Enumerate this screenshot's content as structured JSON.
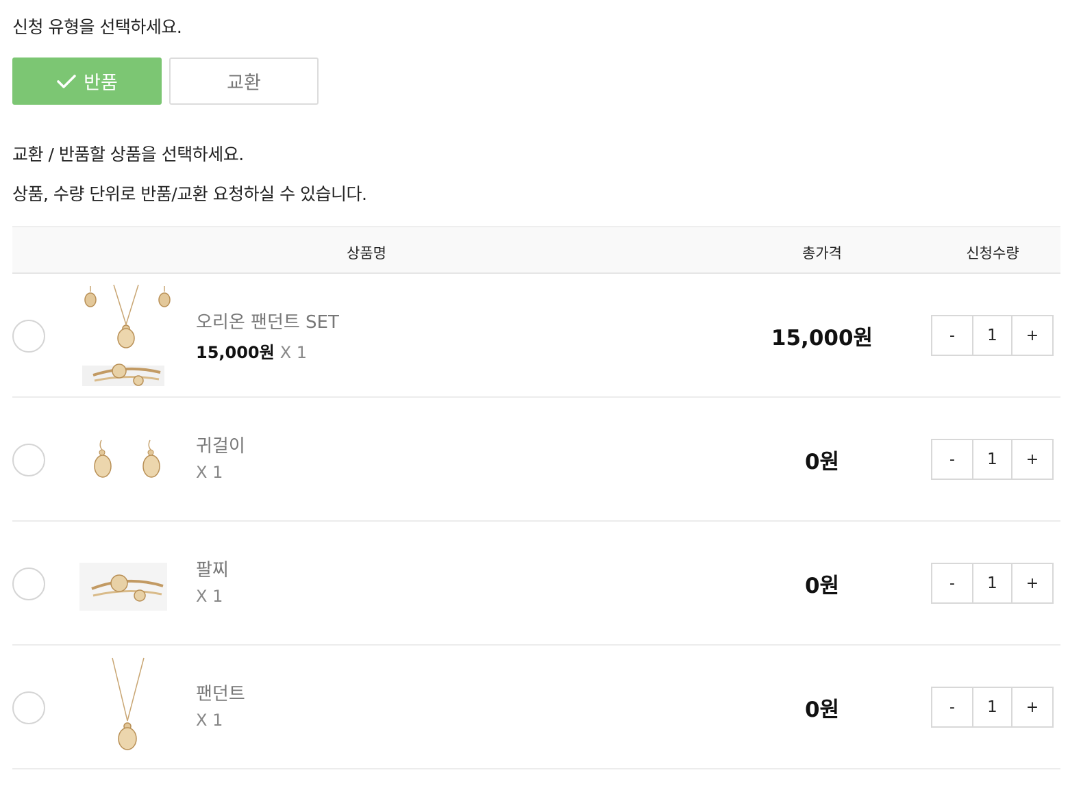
{
  "prompts": {
    "select_type": "신청 유형을 선택하세요.",
    "select_items": "교환 / 반품할 상품을 선택하세요.",
    "unit_note": "상품, 수량 단위로 반품/교환 요청하실 수 있습니다."
  },
  "type_buttons": {
    "return_label": "반품",
    "exchange_label": "교환",
    "selected": "반품",
    "accent_color": "#7cc673"
  },
  "table": {
    "headers": {
      "name": "상품명",
      "price": "총가격",
      "qty": "신청수량"
    },
    "rows": [
      {
        "name": "오리온 팬던트 SET",
        "unit_price": "15,000원",
        "multiplier": "X 1",
        "total": "15,000원",
        "qty": "1",
        "minus": "-",
        "plus": "+",
        "image_icon": "jewelry-set-icon"
      },
      {
        "name": "귀걸이",
        "unit_price": "",
        "multiplier": "X 1",
        "total": "0원",
        "qty": "1",
        "minus": "-",
        "plus": "+",
        "image_icon": "earrings-icon"
      },
      {
        "name": "팔찌",
        "unit_price": "",
        "multiplier": "X 1",
        "total": "0원",
        "qty": "1",
        "minus": "-",
        "plus": "+",
        "image_icon": "bracelet-icon"
      },
      {
        "name": "팬던트",
        "unit_price": "",
        "multiplier": "X 1",
        "total": "0원",
        "qty": "1",
        "minus": "-",
        "plus": "+",
        "image_icon": "pendant-icon"
      }
    ]
  }
}
